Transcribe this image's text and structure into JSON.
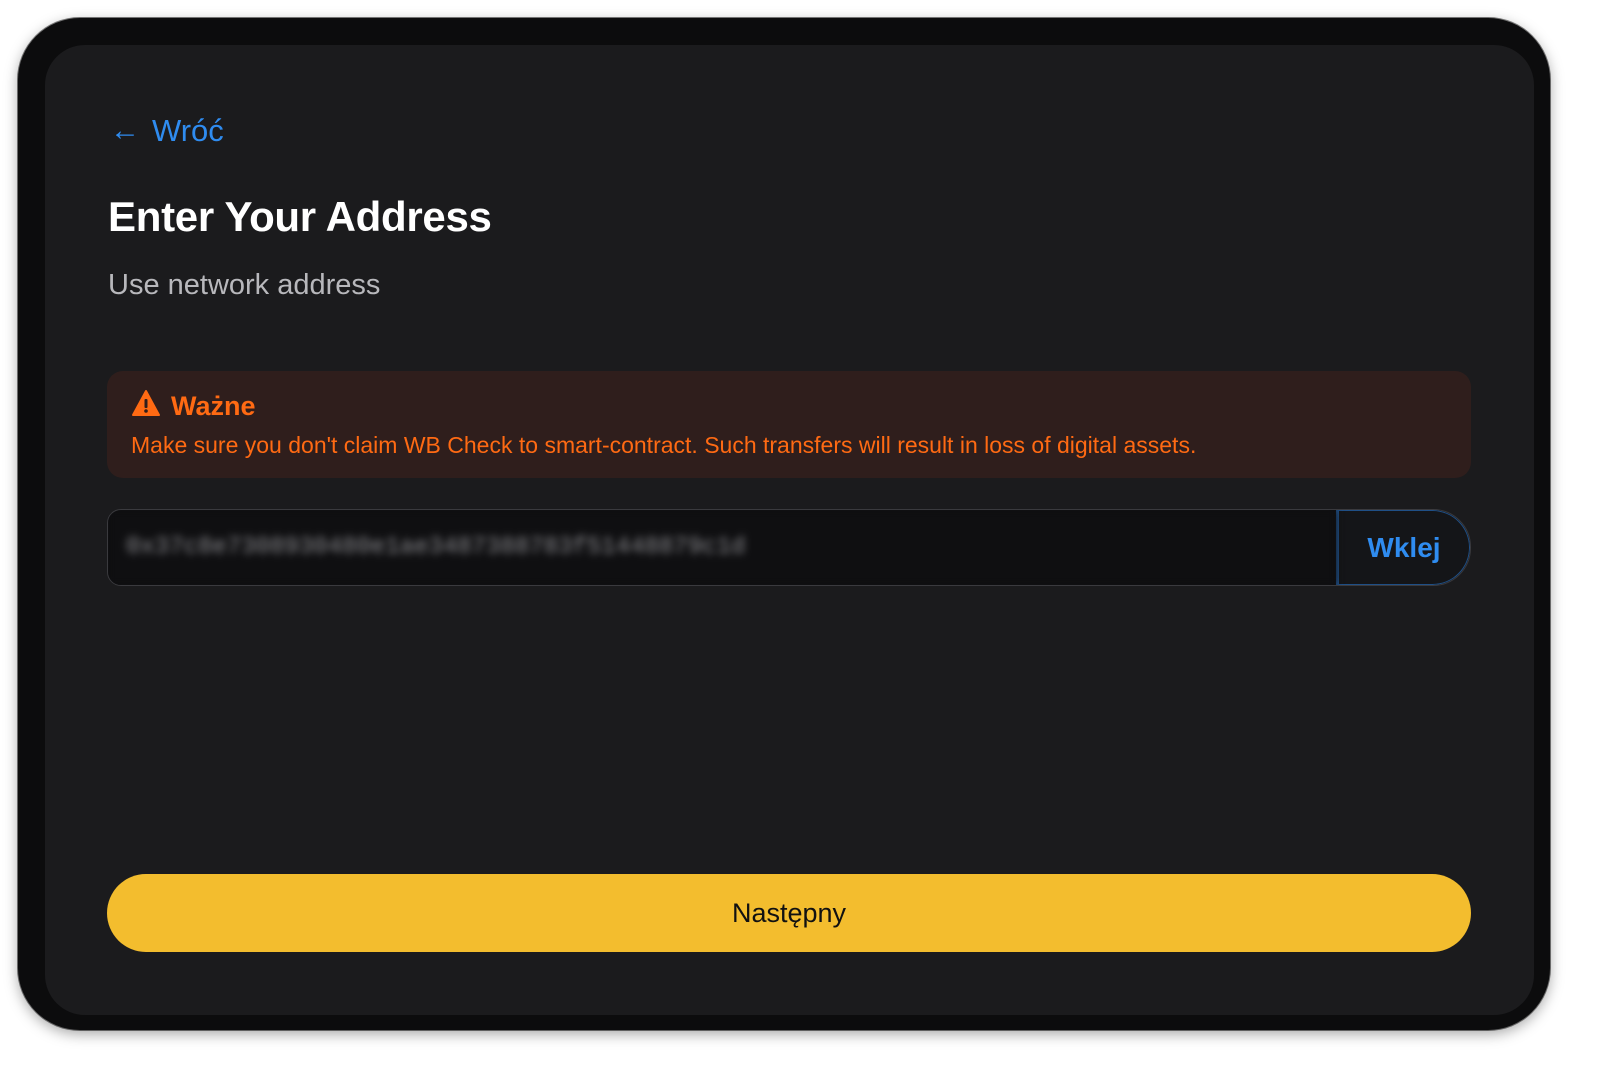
{
  "navigation": {
    "back_icon": "arrow-left-icon",
    "back_label": "Wróć"
  },
  "header": {
    "title": "Enter Your Address",
    "subtitle": "Use network address"
  },
  "warning": {
    "icon": "warning-triangle-icon",
    "title": "Ważne",
    "message": "Make sure you don't claim WB Check to smart-contract. Such transfers will result in loss of digital assets."
  },
  "address": {
    "value": "0x37c8e7308930480e1ae3487388783f51448879c1d"
  },
  "actions": {
    "paste_label": "Wklej",
    "next_label": "Następny"
  },
  "colors": {
    "accent_blue": "#2f8cf0",
    "warning_orange": "#ff6a13",
    "warning_background": "#2f1e1c",
    "primary_yellow": "#f3bd2e",
    "screen_background": "#1b1b1d"
  }
}
